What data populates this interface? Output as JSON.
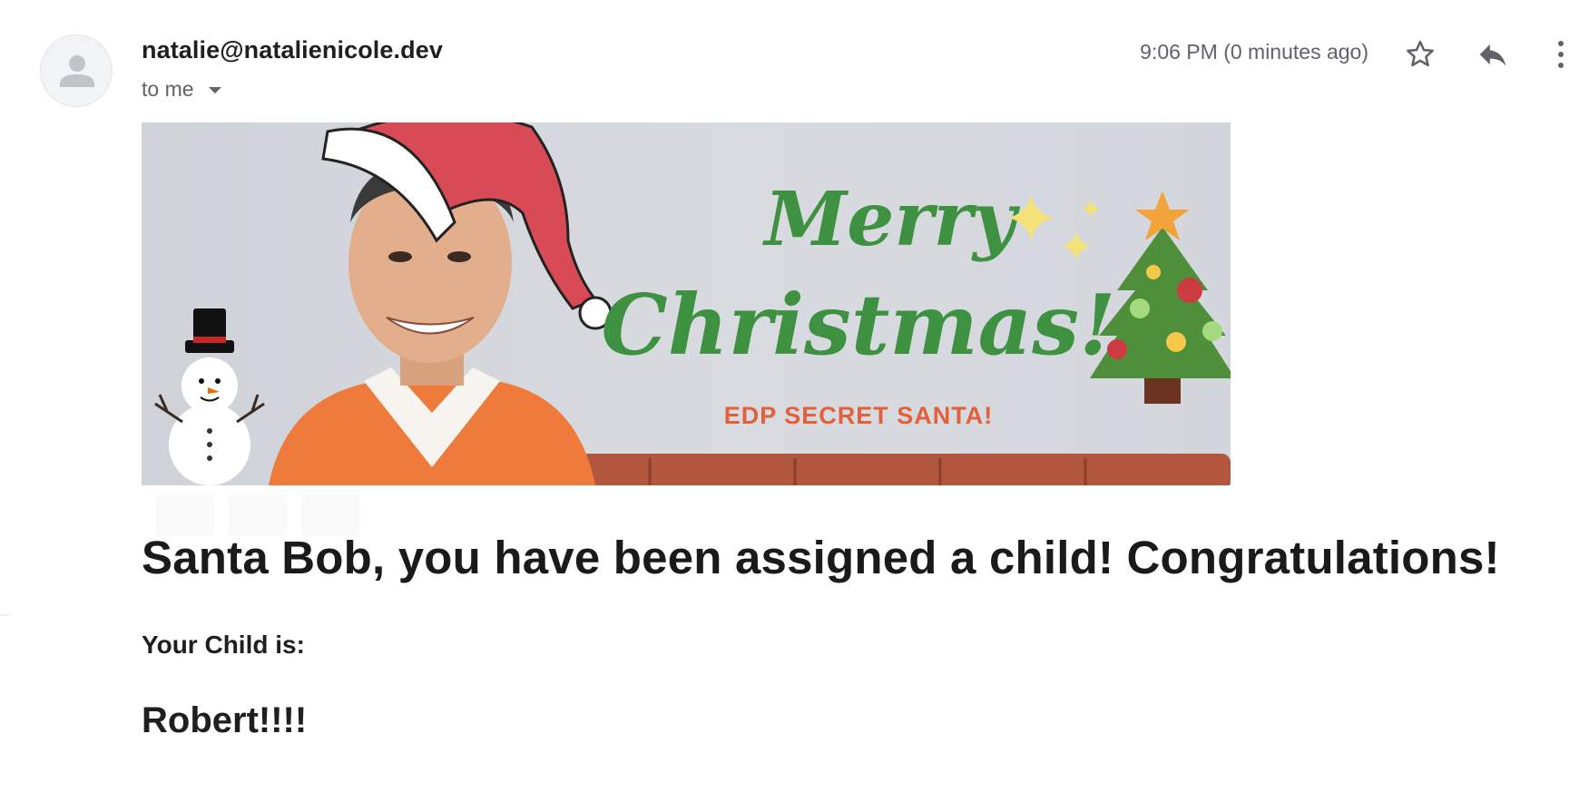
{
  "email": {
    "sender": "natalie@natalienicole.dev",
    "recipient_label": "to me",
    "timestamp": "9:06 PM (0 minutes ago)"
  },
  "banner": {
    "greeting_line1": "Merry",
    "greeting_line2": "Christmas!",
    "subtitle": "EDP SECRET SANTA!"
  },
  "body": {
    "headline": "Santa Bob, you have been assigned a child! Congratulations!",
    "child_label": "Your Child is:",
    "child_name": "Robert!!!!"
  },
  "icons": {
    "avatar": "person-icon",
    "star": "star-outline-icon",
    "reply": "reply-icon",
    "more": "more-vertical-icon",
    "recipient_dropdown": "caret-down-icon"
  },
  "colors": {
    "greeting_green": "#3e9141",
    "subtitle_orange": "#e2603a",
    "hat_red": "#d94a57",
    "sweater_orange": "#ee7a3c",
    "sofa_brown": "#b2573d",
    "muted_text": "#5f6368"
  }
}
